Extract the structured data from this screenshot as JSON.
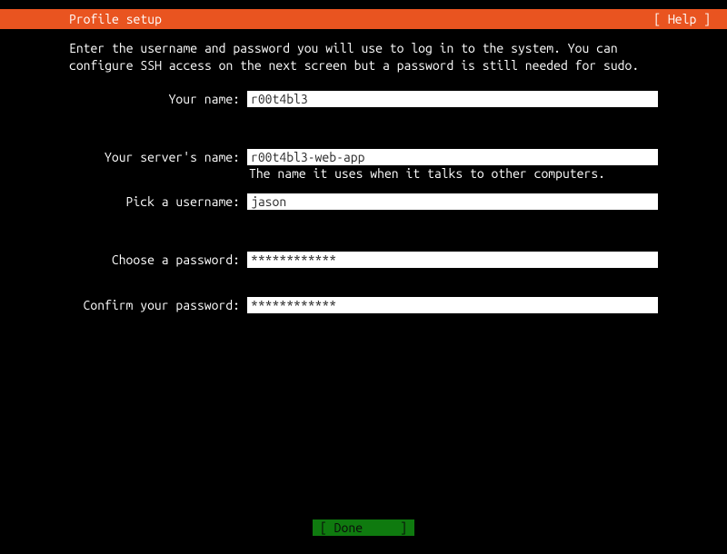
{
  "header": {
    "title": "Profile setup",
    "help": "[ Help ]"
  },
  "instructions": "Enter the username and password you will use to log in to the system. You can configure SSH access on the next screen but a password is still needed for sudo.",
  "fields": {
    "name": {
      "label": "Your name:",
      "value": "r00t4bl3"
    },
    "server": {
      "label": "Your server's name:",
      "value": "r00t4bl3-web-app",
      "hint": "The name it uses when it talks to other computers."
    },
    "username": {
      "label": "Pick a username:",
      "value": "jason"
    },
    "password": {
      "label": "Choose a password:",
      "value": "************"
    },
    "confirm": {
      "label": "Confirm your password:",
      "value": "************"
    }
  },
  "footer": {
    "done_left": "[ Done",
    "done_right": "]"
  }
}
